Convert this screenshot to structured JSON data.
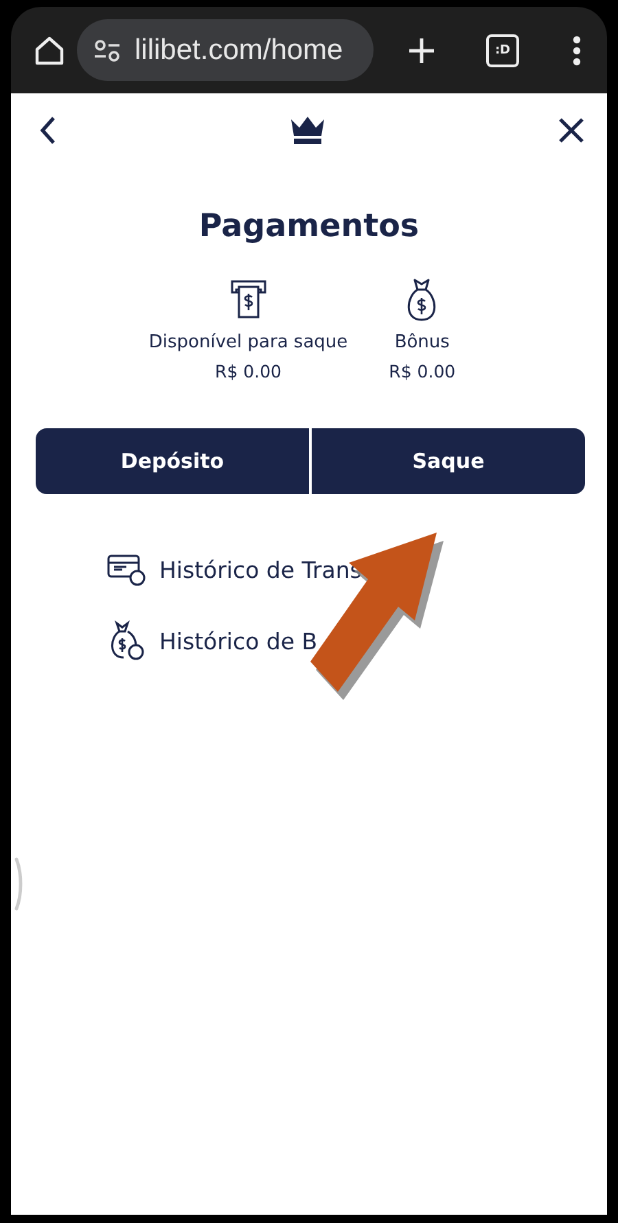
{
  "browser": {
    "url": "lilibet.com/home",
    "tab_count": ":D"
  },
  "page": {
    "title": "Pagamentos"
  },
  "balances": [
    {
      "kind": "withdrawable",
      "label": "Disponível para saque",
      "amount": "R$ 0.00"
    },
    {
      "kind": "bonus",
      "label": "Bônus",
      "amount": "R$ 0.00"
    }
  ],
  "tabs": [
    {
      "label": "Depósito",
      "selected": false
    },
    {
      "label": "Saque",
      "selected": false
    }
  ],
  "links": [
    {
      "kind": "transactions",
      "label": "Histórico de Trans"
    },
    {
      "kind": "bonus",
      "label": "Histórico de B"
    }
  ]
}
